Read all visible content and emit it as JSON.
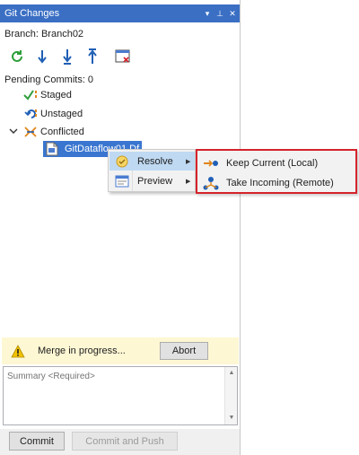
{
  "window": {
    "title": "Git Changes",
    "controls": [
      "▾",
      "⊥",
      "✕"
    ]
  },
  "branch_label": "Branch: Branch02",
  "toolbar": {
    "icons": [
      "sync-icon",
      "fetch-icon",
      "pull-icon",
      "push-icon",
      "view-window-icon"
    ]
  },
  "pending_commits": "Pending Commits:  0",
  "tree": {
    "staged": "Staged",
    "unstaged": "Unstaged",
    "conflicted": "Conflicted",
    "conflict_file": "GitDataflow01.Df"
  },
  "context_menu": {
    "resolve": "Resolve",
    "preview": "Preview"
  },
  "submenu": {
    "keep_current": "Keep Current (Local)",
    "take_incoming": "Take Incoming (Remote)"
  },
  "merge": {
    "message": "Merge in progress...",
    "abort_label": "Abort"
  },
  "summary": {
    "placeholder": "Summary <Required>"
  },
  "actions": {
    "commit_label": "Commit",
    "commit_push_label": "Commit and Push"
  },
  "colors": {
    "titlebar": "#3a6fc4",
    "selection": "#3a76d0",
    "submenu_border": "#d5232b",
    "merge_banner": "#fdf7d4"
  }
}
